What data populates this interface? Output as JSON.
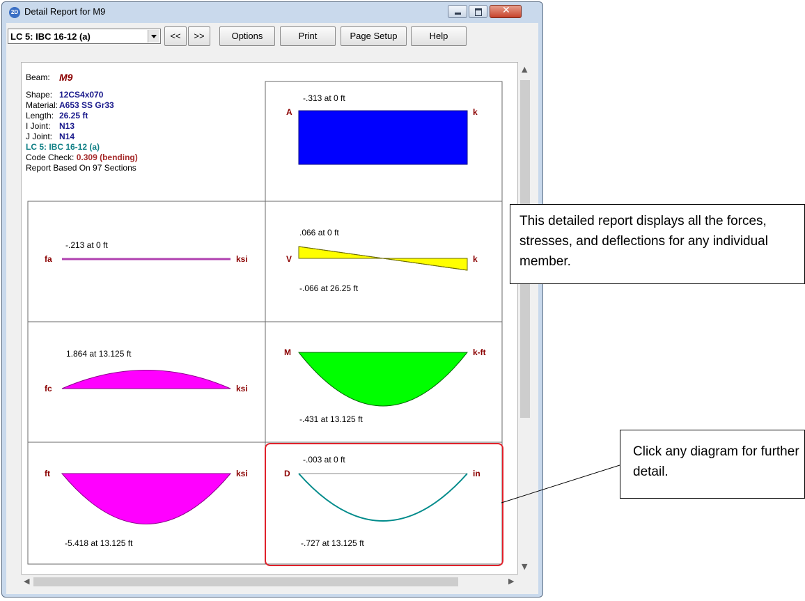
{
  "window": {
    "title": "Detail Report for M9",
    "icon_text": "2D"
  },
  "toolbar": {
    "load_case": "LC 5: IBC 16-12 (a)",
    "prev_label": "<<",
    "next_label": ">>",
    "options_label": "Options",
    "print_label": "Print",
    "page_setup_label": "Page Setup",
    "help_label": "Help"
  },
  "info": {
    "beam_label": "Beam:",
    "beam_value": "M9",
    "shape_label": "Shape:",
    "shape_value": "12CS4x070",
    "material_label": "Material:",
    "material_value": "A653 SS Gr33",
    "length_label": "Length:",
    "length_value": "26.25 ft",
    "i_joint_label": "I Joint:",
    "i_joint_value": "N13",
    "j_joint_label": "J Joint:",
    "j_joint_value": "N14",
    "load_case": "LC 5: IBC 16-12 (a)",
    "code_check_label": "Code Check:",
    "code_check_value": "0.309",
    "code_check_type": "(bending)",
    "sections": "Report Based On 97 Sections"
  },
  "diagrams": {
    "axial": {
      "label": "A",
      "unit": "k",
      "top_text": "-.313 at 0 ft",
      "color": "#0000ff"
    },
    "fa": {
      "label": "fa",
      "unit": "ksi",
      "top_text": "-.213 at 0 ft",
      "color": "#b040b0"
    },
    "shear": {
      "label": "V",
      "unit": "k",
      "top_text": ".066 at 0 ft",
      "bottom_text": "-.066 at 26.25 ft",
      "color": "#ffff00"
    },
    "fc": {
      "label": "fc",
      "unit": "ksi",
      "top_text": "1.864 at 13.125 ft",
      "color": "#ff00ff"
    },
    "moment": {
      "label": "M",
      "unit": "k-ft",
      "bottom_text": "-.431 at 13.125 ft",
      "color": "#00ff00"
    },
    "ft": {
      "label": "ft",
      "unit": "ksi",
      "bottom_text": "-5.418 at 13.125 ft",
      "color": "#ff00ff"
    },
    "deflection": {
      "label": "D",
      "unit": "in",
      "top_text": "-.003 at 0 ft",
      "bottom_text": "-.727 at 13.125 ft",
      "color": "#008b8b"
    }
  },
  "colors": {
    "label_text": "#8b0000",
    "highlight": "#e0202a"
  },
  "callouts": {
    "report_note": "This detailed report displays all the forces, stresses, and deflections for any individual member.",
    "click_note": "Click any diagram for further detail."
  }
}
